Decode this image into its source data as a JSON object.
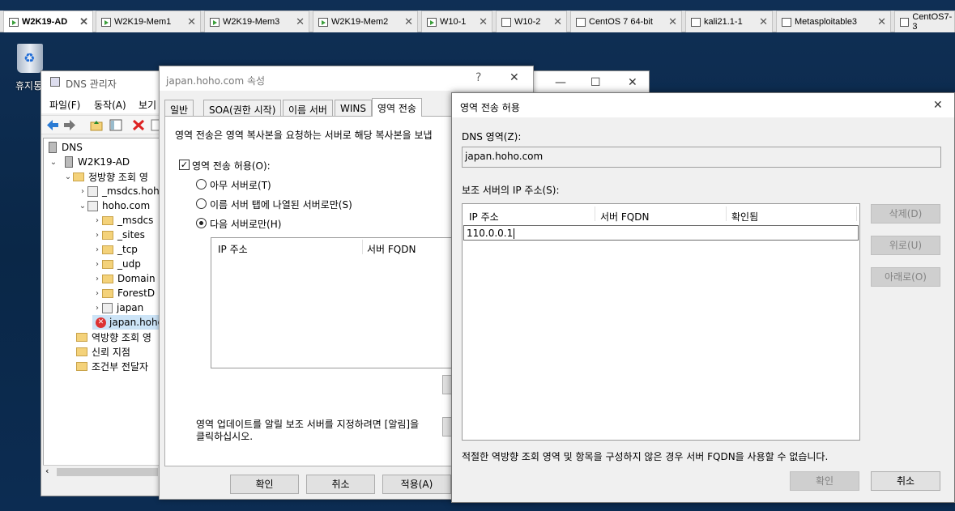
{
  "vm_tabs": [
    {
      "label": "W2K19-AD",
      "active": true
    },
    {
      "label": "W2K19-Mem1"
    },
    {
      "label": "W2K19-Mem3"
    },
    {
      "label": "W2K19-Mem2"
    },
    {
      "label": "W10-1"
    },
    {
      "label": "W10-2"
    },
    {
      "label": "CentOS 7 64-bit"
    },
    {
      "label": "kali21.1-1"
    },
    {
      "label": "Metasploitable3"
    },
    {
      "label": "CentOS7-3"
    }
  ],
  "desktop": {
    "recycle_bin_label": "휴지통"
  },
  "dns_manager": {
    "title": "DNS 관리자",
    "menu": [
      "파일(F)",
      "동작(A)",
      "보기"
    ],
    "tree": [
      {
        "label": "DNS"
      },
      {
        "label": "W2K19-AD"
      },
      {
        "label": "정방향 조회 영"
      },
      {
        "label": "_msdcs.hoh"
      },
      {
        "label": "hoho.com"
      },
      {
        "label": "_msdcs"
      },
      {
        "label": "_sites"
      },
      {
        "label": "_tcp"
      },
      {
        "label": "_udp"
      },
      {
        "label": "Domain"
      },
      {
        "label": "ForestD"
      },
      {
        "label": "japan"
      },
      {
        "label": "japan.hoho."
      },
      {
        "label": "역방향 조회 영"
      },
      {
        "label": "신뢰 지점"
      },
      {
        "label": "조건부 전달자"
      }
    ]
  },
  "properties_dialog": {
    "title": "japan.hoho.com 속성",
    "help_glyph": "?",
    "tabs": [
      "일반",
      "SOA(권한 시작)",
      "이름 서버",
      "WINS",
      "영역 전송"
    ],
    "description": "영역 전송은 영역 복사본을 요청하는 서버로 해당 복사본을 보냅",
    "allow_transfer_label": "영역 전송 허용(O):",
    "allow_transfer_checked": true,
    "radio_options": [
      {
        "label": "아무 서버로(T)",
        "selected": false
      },
      {
        "label": "이름 서버 탭에 나열된 서버로만(S)",
        "selected": false
      },
      {
        "label": "다음 서버로만(H)",
        "selected": true
      }
    ],
    "list_columns": [
      "IP 주소",
      "서버 FQDN"
    ],
    "notify_text_1": "영역 업데이트를 알릴 보조 서버를 지정하려면 [알림]을",
    "notify_text_2": "클릭하십시오.",
    "buttons": {
      "ok": "확인",
      "cancel": "취소",
      "apply": "적용(A)"
    }
  },
  "zone_transfer_dialog": {
    "title": "영역 전송 허용",
    "dns_zone_label": "DNS 영역(Z):",
    "dns_zone_value": "japan.hoho.com",
    "secondary_ip_label": "보조 서버의 IP 주소(S):",
    "columns": [
      "IP 주소",
      "서버 FQDN",
      "확인됨"
    ],
    "ip_entry_value": "110.0.0.1",
    "side_buttons": [
      "삭제(D)",
      "위로(U)",
      "아래로(O)"
    ],
    "footer_note": "적절한 역방향 조회 영역 및 항목을 구성하지 않은 경우 서버 FQDN을 사용할 수 없습니다.",
    "ok_label": "확인",
    "cancel_label": "취소"
  }
}
